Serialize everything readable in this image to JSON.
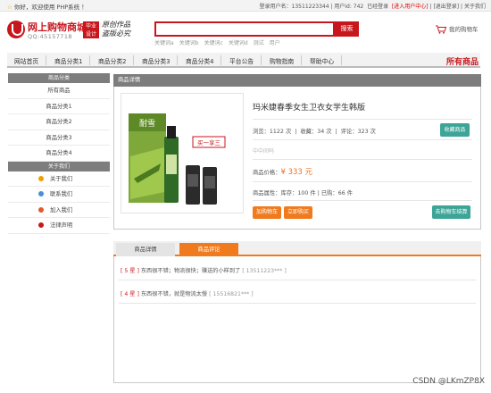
{
  "topbar": {
    "welcome": "你好，欢迎使用 PHP系统 ！",
    "user": "登录用户名：13511223344",
    "user_id": "用户id: 742",
    "logged_in": "已经登录",
    "user_center": "[进入用户中心]",
    "logout": "[退出登录]",
    "about": "关于我们"
  },
  "logo": {
    "title": "网上购物商城",
    "qq": "QQ:45157718",
    "badge_line1": "毕业",
    "badge_line2": "设计",
    "slogan": "原创作品 盗版必究"
  },
  "search": {
    "placeholder": "",
    "button": "搜索",
    "hotwords": [
      "关键词a",
      "关键词b",
      "关键词c",
      "关键词d",
      "测试",
      "用户"
    ]
  },
  "cart": {
    "label": "我的购物车"
  },
  "nav": {
    "items": [
      "网站首页",
      "商品分类1",
      "商品分类2",
      "商品分类3",
      "商品分类4",
      "平台公告",
      "购物指南",
      "帮助中心"
    ],
    "all_goods": "所有商品"
  },
  "sidebar": {
    "categories_title": "商品分类",
    "categories": [
      "所有商品",
      "商品分类1",
      "商品分类2",
      "商品分类3",
      "商品分类4"
    ],
    "about_title": "关于我们",
    "about_items": [
      {
        "label": "关于我们",
        "icon": "info-icon",
        "color": "#f0a000"
      },
      {
        "label": "联系我们",
        "icon": "contact-icon",
        "color": "#4a8fd8"
      },
      {
        "label": "加入我们",
        "icon": "join-icon",
        "color": "#e05a2a"
      },
      {
        "label": "法律声明",
        "icon": "legal-icon",
        "color": "#c8161d"
      }
    ]
  },
  "product": {
    "panel_title": "商品详情",
    "name": "玛米婕春季女生卫衣女学生韩版",
    "views_label": "浏览：",
    "views": "1122",
    "views_unit": "次",
    "favorites_label": "收藏：",
    "favorites": "34",
    "favorites_unit": "次",
    "comments_label": "评论：",
    "comments": "323",
    "comments_unit": "次",
    "favorite_button": "收藏商品",
    "sample": "中中间吗",
    "price_label": "商品价格：",
    "price": "¥ 333 元",
    "attributes": "商品属性：库存：100 件 | 已购：66 件",
    "add_cart_button": "加购物车",
    "buy_now_button": "立即购买",
    "checkout_button": "去购物车结算",
    "image_text": {
      "brand": "耐雪",
      "promo": "买一享三"
    }
  },
  "tabs": {
    "items": [
      "商品详情",
      "商品评论"
    ],
    "active": "商品评论"
  },
  "reviews": [
    {
      "stars": "5 星",
      "text": "东西很不错；物流很快；赚送的小样到了",
      "user": "13511223***"
    },
    {
      "stars": "4 星",
      "text": "东西很不错，就是物流太慢",
      "user": "15516821***"
    }
  ],
  "watermark": "CSDN @LKmZP8X",
  "colors": {
    "brand_red": "#c8161d",
    "orange": "#f07b1f",
    "teal": "#3da598",
    "panel_gray": "#7d7d7d"
  }
}
